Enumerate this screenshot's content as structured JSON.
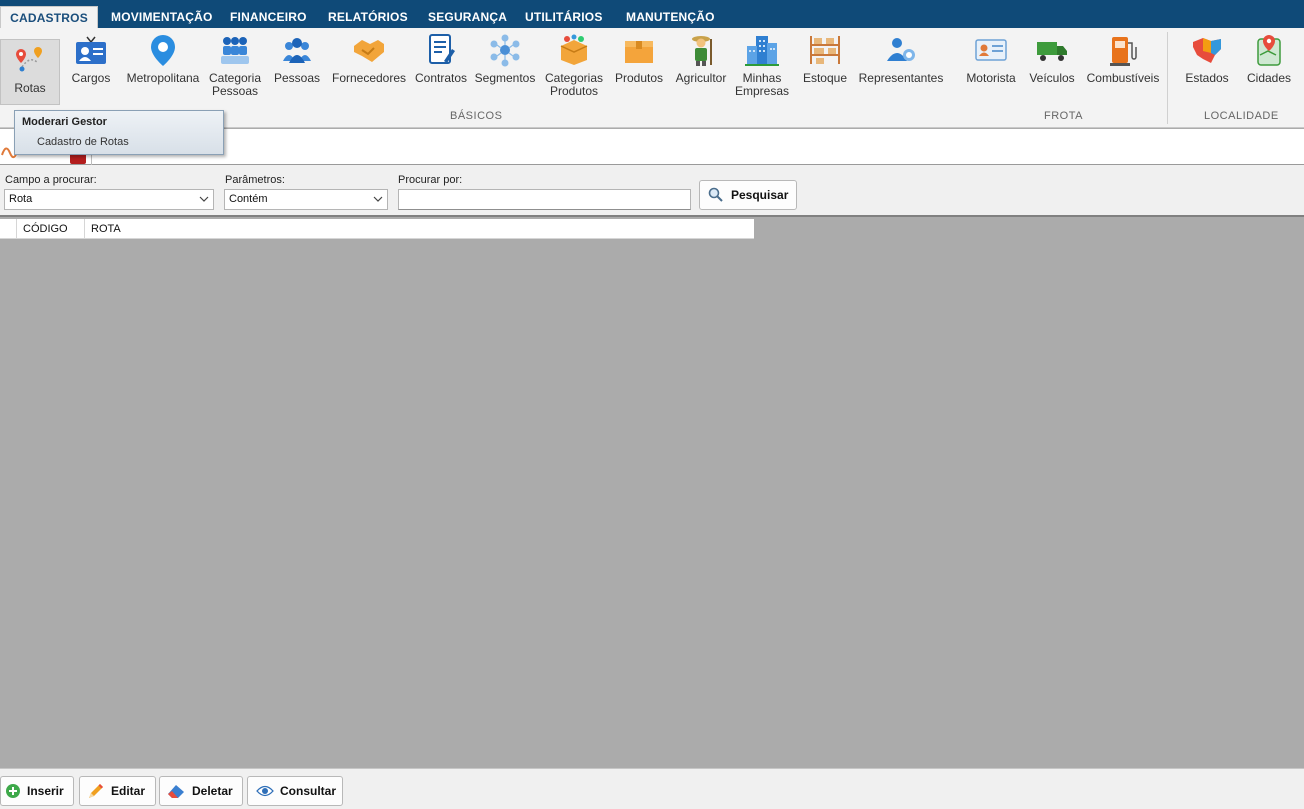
{
  "menu": {
    "tabs": [
      {
        "label": "CADASTROS",
        "active": true
      },
      {
        "label": "MOVIMENTAÇÃO"
      },
      {
        "label": "FINANCEIRO"
      },
      {
        "label": "RELATÓRIOS"
      },
      {
        "label": "SEGURANÇA"
      },
      {
        "label": "UTILITÁRIOS"
      },
      {
        "label": "MANUTENÇÃO"
      }
    ]
  },
  "ribbon": {
    "buttons": {
      "rotas": {
        "label": "Rotas",
        "icon": "route-pin-icon"
      },
      "cargos": {
        "label": "Cargos",
        "icon": "id-card-icon"
      },
      "metropolitana": {
        "label": "Metropolitana",
        "icon": "map-pin-icon"
      },
      "categoria_pessoas": {
        "label1": "Categoria",
        "label2": "Pessoas",
        "icon": "people-group-icon"
      },
      "pessoas": {
        "label": "Pessoas",
        "icon": "people-icon"
      },
      "fornecedores": {
        "label": "Fornecedores",
        "icon": "handshake-icon"
      },
      "contratos": {
        "label": "Contratos",
        "icon": "contract-icon"
      },
      "segmentos": {
        "label": "Segmentos",
        "icon": "network-icon"
      },
      "categorias_produtos": {
        "label1": "Categorias",
        "label2": "Produtos",
        "icon": "product-categories-icon"
      },
      "produtos": {
        "label": "Produtos",
        "icon": "box-icon"
      },
      "agricultor": {
        "label": "Agricultor",
        "icon": "farmer-icon"
      },
      "minhas_empresas": {
        "label1": "Minhas",
        "label2": "Empresas",
        "icon": "buildings-icon"
      },
      "estoque": {
        "label": "Estoque",
        "icon": "shelves-icon"
      },
      "representantes": {
        "label": "Representantes",
        "icon": "representative-icon"
      },
      "motorista": {
        "label": "Motorista",
        "icon": "driver-license-icon"
      },
      "veiculos": {
        "label": "Veículos",
        "icon": "truck-icon"
      },
      "combustiveis": {
        "label": "Combustíveis",
        "icon": "fuel-pump-icon"
      },
      "estados": {
        "label": "Estados",
        "icon": "states-map-icon"
      },
      "cidades": {
        "label": "Cidades",
        "icon": "city-map-icon"
      }
    },
    "groups": {
      "basicos": "BÁSICOS",
      "frota": "FROTA",
      "localidade": "LOCALIDADE"
    }
  },
  "tooltip": {
    "title": "Moderari Gestor",
    "body": "Cadastro de Rotas"
  },
  "search": {
    "field_label": "Campo a procurar:",
    "field_value": "Rota",
    "params_label": "Parâmetros:",
    "params_value": "Contém",
    "query_label": "Procurar por:",
    "query_value": "",
    "search_button": "Pesquisar"
  },
  "grid": {
    "columns": [
      "CÓDIGO",
      "ROTA"
    ]
  },
  "actions": {
    "insert": "Inserir",
    "edit": "Editar",
    "delete": "Deletar",
    "consult": "Consultar"
  },
  "colors": {
    "menubar": "#0f4a78",
    "ribbon": "#f3f3f3",
    "grid_background": "#ababab"
  }
}
